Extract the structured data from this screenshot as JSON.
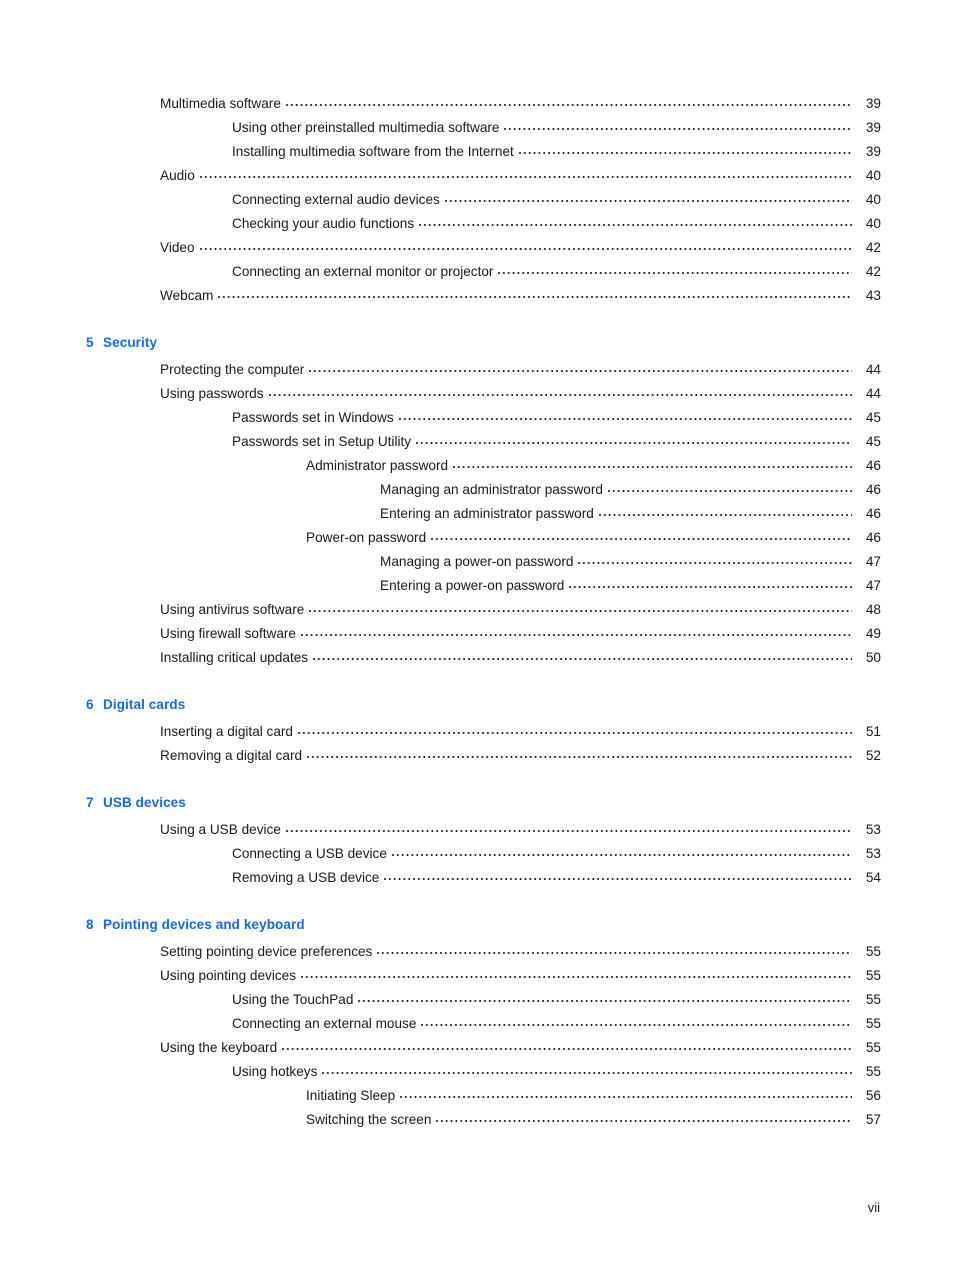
{
  "document": {
    "type": "table-of-contents",
    "footer_page_label": "vii",
    "accent_color": "#1569e8",
    "text_color": "#1a1a1a"
  },
  "toc": {
    "groups": [
      {
        "chapter_number": "",
        "chapter_title": "",
        "has_heading": false,
        "entries": [
          {
            "level": 1,
            "label": "Multimedia software",
            "page": "39"
          },
          {
            "level": 2,
            "label": "Using other preinstalled multimedia software",
            "page": "39"
          },
          {
            "level": 2,
            "label": "Installing multimedia software from the Internet",
            "page": "39"
          },
          {
            "level": 1,
            "label": "Audio",
            "page": "40"
          },
          {
            "level": 2,
            "label": "Connecting external audio devices",
            "page": "40"
          },
          {
            "level": 2,
            "label": "Checking your audio functions",
            "page": "40"
          },
          {
            "level": 1,
            "label": "Video",
            "page": "42"
          },
          {
            "level": 2,
            "label": "Connecting an external monitor or projector",
            "page": "42"
          },
          {
            "level": 1,
            "label": "Webcam",
            "page": "43"
          }
        ]
      },
      {
        "chapter_number": "5",
        "chapter_title": "Security",
        "has_heading": true,
        "entries": [
          {
            "level": 1,
            "label": "Protecting the computer",
            "page": "44"
          },
          {
            "level": 1,
            "label": "Using passwords",
            "page": "44"
          },
          {
            "level": 2,
            "label": "Passwords set in Windows",
            "page": "45"
          },
          {
            "level": 2,
            "label": "Passwords set in Setup Utility",
            "page": "45"
          },
          {
            "level": 3,
            "label": "Administrator password",
            "page": "46"
          },
          {
            "level": 4,
            "label": "Managing an administrator password",
            "page": "46"
          },
          {
            "level": 4,
            "label": "Entering an administrator password",
            "page": "46"
          },
          {
            "level": 3,
            "label": "Power-on password",
            "page": "46"
          },
          {
            "level": 4,
            "label": "Managing a power-on password",
            "page": "47"
          },
          {
            "level": 4,
            "label": "Entering a power-on password",
            "page": "47"
          },
          {
            "level": 1,
            "label": "Using antivirus software",
            "page": "48"
          },
          {
            "level": 1,
            "label": "Using firewall software",
            "page": "49"
          },
          {
            "level": 1,
            "label": "Installing critical updates",
            "page": "50"
          }
        ]
      },
      {
        "chapter_number": "6",
        "chapter_title": "Digital cards",
        "has_heading": true,
        "entries": [
          {
            "level": 1,
            "label": "Inserting a digital card",
            "page": "51"
          },
          {
            "level": 1,
            "label": "Removing a digital card",
            "page": "52"
          }
        ]
      },
      {
        "chapter_number": "7",
        "chapter_title": "USB devices",
        "has_heading": true,
        "entries": [
          {
            "level": 1,
            "label": "Using a USB device",
            "page": "53"
          },
          {
            "level": 2,
            "label": "Connecting a USB device",
            "page": "53"
          },
          {
            "level": 2,
            "label": "Removing a USB device",
            "page": "54"
          }
        ]
      },
      {
        "chapter_number": "8",
        "chapter_title": "Pointing devices and keyboard",
        "has_heading": true,
        "entries": [
          {
            "level": 1,
            "label": "Setting pointing device preferences",
            "page": "55"
          },
          {
            "level": 1,
            "label": "Using pointing devices",
            "page": "55"
          },
          {
            "level": 2,
            "label": "Using the TouchPad",
            "page": "55"
          },
          {
            "level": 2,
            "label": "Connecting an external mouse",
            "page": "55"
          },
          {
            "level": 1,
            "label": "Using the keyboard",
            "page": "55"
          },
          {
            "level": 2,
            "label": "Using hotkeys",
            "page": "55"
          },
          {
            "level": 3,
            "label": "Initiating Sleep",
            "page": "56"
          },
          {
            "level": 3,
            "label": "Switching the screen ",
            "page": "57"
          }
        ]
      }
    ]
  }
}
